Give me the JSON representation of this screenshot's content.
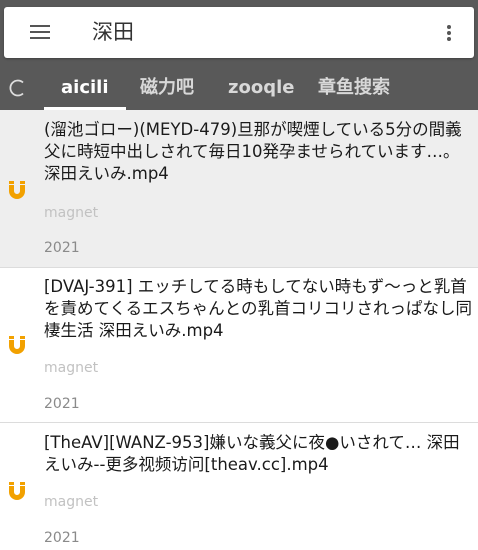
{
  "search": {
    "query": "深田"
  },
  "tabs": [
    {
      "label": "aicili",
      "active": true
    },
    {
      "label": "磁力吧",
      "active": false
    },
    {
      "label": "zooqle",
      "active": false
    },
    {
      "label": "章鱼搜索",
      "active": false
    }
  ],
  "results": [
    {
      "title": "(溜池ゴロー)(MEYD-479)旦那が喫煙している5分の間義父に時短中出しされて毎日10発孕ませられています…。深田えいみ.mp4",
      "link_label": "magnet",
      "year": "2021"
    },
    {
      "title": "[DVAJ-391] エッチしてる時もしてない時もず～っと乳首を責めてくるエスちゃんとの乳首コリコリされっぱなし同棲生活 深田えいみ.mp4",
      "link_label": "magnet",
      "year": "2021"
    },
    {
      "title": "[TheAV][WANZ-953]嫌いな義父に夜●いされて… 深田えいみ--更多视频访问[theav.cc].mp4",
      "link_label": "magnet",
      "year": "2021"
    }
  ],
  "colors": {
    "toolbar": "#595959",
    "magnet_icon": "#f2a100",
    "selected_row": "#eeeeee"
  },
  "icons": {
    "menu": "hamburger-icon",
    "more": "kebab-icon",
    "refresh": "refresh-icon",
    "magnet": "magnet-icon"
  }
}
